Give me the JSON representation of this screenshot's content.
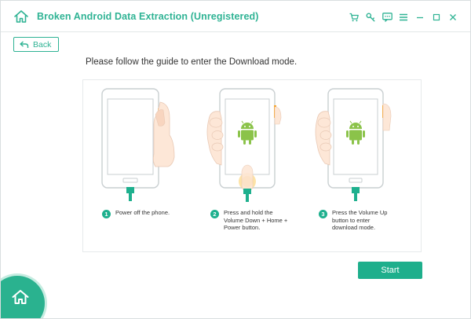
{
  "app": {
    "title": "Broken Android Data Extraction (Unregistered)"
  },
  "colors": {
    "accent": "#2fb394",
    "button": "#1eaf8c"
  },
  "titlebar_icons": [
    "cart-icon",
    "key-icon",
    "feedback-icon",
    "menu-icon",
    "minimize-icon",
    "maximize-icon",
    "close-icon"
  ],
  "nav": {
    "back_label": "Back"
  },
  "guide": {
    "heading": "Please follow the guide to enter the Download mode.",
    "steps": [
      {
        "number": "1",
        "text": "Power off the phone."
      },
      {
        "number": "2",
        "text": "Press and hold the Volume Down + Home + Power button."
      },
      {
        "number": "3",
        "text": "Press the Volume Up button to enter download mode."
      }
    ]
  },
  "actions": {
    "start_label": "Start"
  }
}
